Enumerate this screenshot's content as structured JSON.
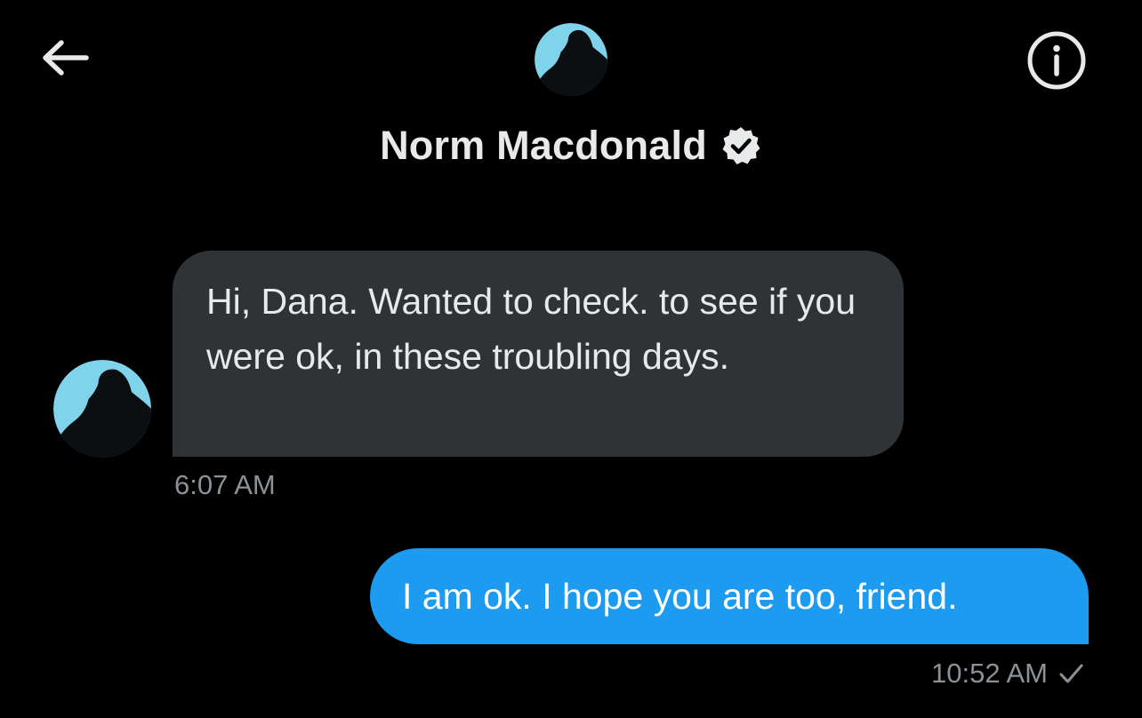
{
  "header": {
    "name": "Norm Macdonald",
    "verified": true,
    "back_icon": "arrow-left-icon",
    "info_icon": "info-circle-icon"
  },
  "messages": [
    {
      "direction": "incoming",
      "text": "Hi, Dana. Wanted to check. to see if you were ok, in these troubling days.",
      "time": "6:07 AM"
    },
    {
      "direction": "outgoing",
      "text": "I am ok. I hope you are too, friend.",
      "time": "10:52 AM",
      "status_icon": "checkmark-icon"
    }
  ],
  "colors": {
    "background": "#000000",
    "incoming_bubble": "#2f3336",
    "outgoing_bubble": "#1d9bf0",
    "timestamp": "#8b9197",
    "avatar_sky": "#7fd3ea"
  }
}
